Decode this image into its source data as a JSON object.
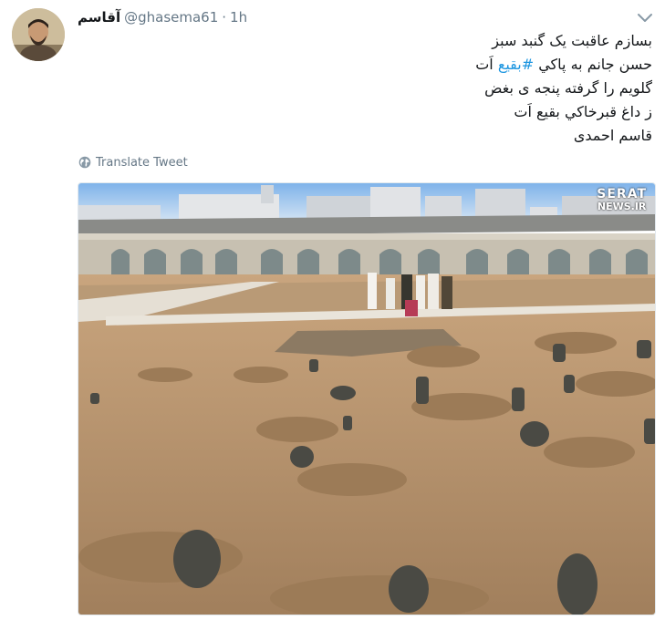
{
  "tweet": {
    "display_name": "آقاسم",
    "handle": "@ghasema61",
    "separator": "·",
    "time": "1h",
    "text_lines": [
      {
        "before": "بسازم عاقبت یک گنبد سبز",
        "hashtag": "",
        "after": ""
      },
      {
        "before": "حسن جانم به پاکي ",
        "hashtag": "#بقیع",
        "after": " اَت"
      },
      {
        "before": "گلویم را گرفته پنجه ی بغض",
        "hashtag": "",
        "after": ""
      },
      {
        "before": "ز داغ قبرخاکي بقیع اَت",
        "hashtag": "",
        "after": ""
      },
      {
        "before": "قاسم احمدی",
        "hashtag": "",
        "after": ""
      }
    ],
    "translate_label": "Translate Tweet",
    "media": {
      "watermark_line1": "SERAT",
      "watermark_line2": "NEWS.IR"
    }
  },
  "colors": {
    "link": "#1b95e0",
    "secondary_text": "#657786",
    "primary_text": "#14171a"
  },
  "icons": {
    "caret": "chevron-down-icon",
    "translate": "globe-icon"
  }
}
